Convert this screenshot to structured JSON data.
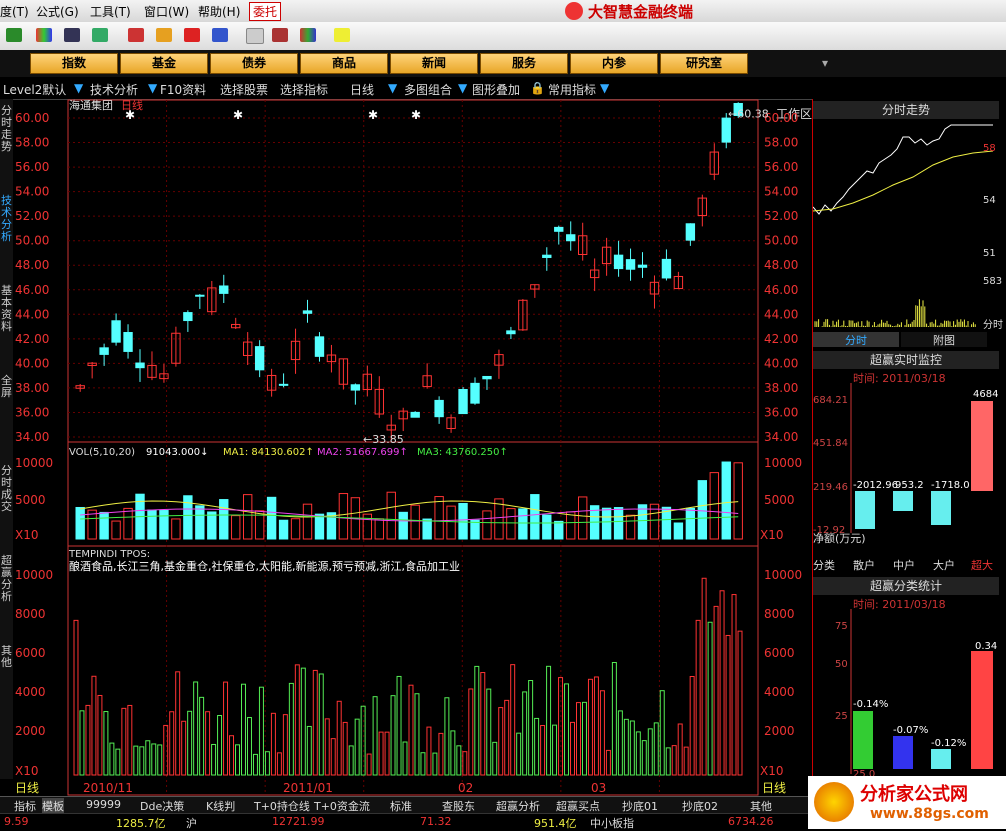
{
  "menu": {
    "items": [
      "度(T)",
      "公式(G)",
      "工具(T)",
      "窗口(W)",
      "帮助(H)"
    ],
    "weituo": "委托",
    "brand": "大智慧金融终端"
  },
  "categories": [
    "指数",
    "基金",
    "债券",
    "商品",
    "新闻",
    "服务",
    "内参",
    "研究室"
  ],
  "workarea": "工作区",
  "subbar": [
    "Level2默认",
    "技术分析",
    "F10资料",
    "选择股票",
    "选择指标",
    "日线",
    "多图组合",
    "图形叠加",
    "常用指标"
  ],
  "right_tabs": [
    "标",
    "⊞",
    "权",
    "线",
    "移",
    "图"
  ],
  "left_tabs": [
    "分时走势",
    "技术分析",
    "基本资料",
    "全屏",
    "分时成交",
    "超赢分析",
    "其他"
  ],
  "chart": {
    "stock_name": "海通集团",
    "period": "日线",
    "high_label": "60.38",
    "low_label": "33.85",
    "price_ticks": [
      "60.00",
      "58.00",
      "56.00",
      "54.00",
      "52.00",
      "50.00",
      "48.00",
      "46.00",
      "44.00",
      "42.00",
      "40.00",
      "38.00",
      "36.00",
      "34.00"
    ],
    "vol_header": {
      "prefix": "VOL(5,10,20)",
      "vol": "91043.000↓",
      "ma1": "MA1: 84130.602↑",
      "ma2": "MA2: 51667.699↑",
      "ma3": "MA3: 43760.250↑"
    },
    "vol_ticks": [
      "10000",
      "5000"
    ],
    "x10": "X10",
    "tpos_header": "TEMPINDI TPOS:",
    "tpos_text": "酿酒食品,长江三角,基金重仓,社保重仓,太阳能,新能源,预亏预减,浙江,食品加工业",
    "tpos_ticks": [
      "10000",
      "8000",
      "6000",
      "4000",
      "2000"
    ],
    "dates": [
      "2010/11",
      "2011/01",
      "02",
      "03"
    ],
    "period_bottom": "日线"
  },
  "right_panel": {
    "fenshi_title": "分时走势",
    "fenshi_ticks": [
      "58",
      "54",
      "51"
    ],
    "fenshi_vol": "583",
    "fenshi_label": "分时",
    "tabs": [
      "分时",
      "附图"
    ],
    "monitor_title": "超赢实时监控",
    "monitor_date": "时间: 2011/03/18",
    "monitor_ticks": [
      "684.21",
      "451.84",
      "219.46",
      "-12.92"
    ],
    "monitor_values": [
      "-2012.96",
      "953.2",
      "-1718.0",
      "4684"
    ],
    "net_label": "净额(万元)",
    "classes": [
      "分类",
      "散户",
      "中户",
      "大户",
      "超大"
    ],
    "class_title": "超赢分类统计",
    "class_date": "时间: 2011/03/18",
    "class_ticks": [
      "75",
      "50",
      "25"
    ],
    "class_values": [
      "-0.14%",
      "-0.07%",
      "-0.12%",
      "0.34"
    ],
    "class_bottom": "25.0"
  },
  "bottom_tabs": [
    "指标",
    "模板",
    "99999",
    "Dde决策",
    "K线判",
    "T+0持仓线",
    "T+0资金流",
    "标准",
    "查股东",
    "超赢分析",
    "超赢买点",
    "抄底01",
    "抄底02",
    "其他"
  ],
  "ticker": [
    "9.59",
    "1285.7亿",
    "沪",
    "12721.99",
    "71.32",
    "951.4亿",
    "中小板指",
    "6734.26"
  ],
  "logo": {
    "name": "分析家公式网",
    "url": "www.88gs.com"
  }
}
